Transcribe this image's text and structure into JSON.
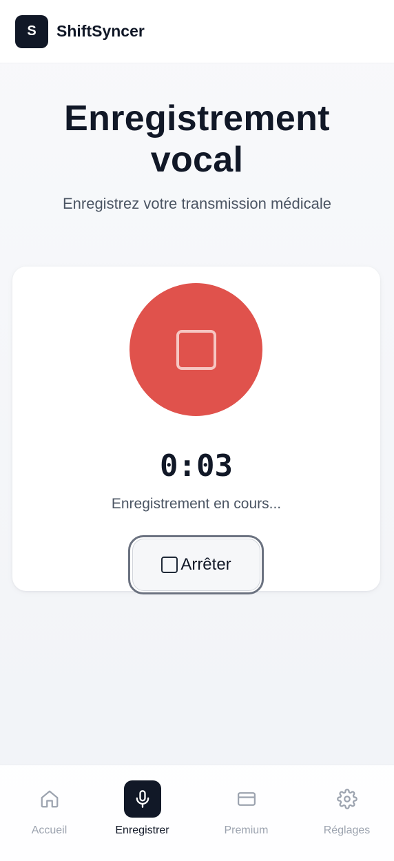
{
  "app": {
    "logo_letter": "S",
    "name": "ShiftSyncer"
  },
  "page": {
    "title_line1": "Enregistrement",
    "title_line2": "vocal",
    "subtitle": "Enregistrez votre transmission médicale"
  },
  "recorder": {
    "timer": "0:03",
    "status": "Enregistrement en cours...",
    "stop_label": "Arrêter",
    "accent_color": "#e0524c"
  },
  "nav": {
    "items": [
      {
        "label": "Accueil",
        "icon": "home-icon"
      },
      {
        "label": "Enregistrer",
        "icon": "microphone-icon",
        "active": true
      },
      {
        "label": "Premium",
        "icon": "credit-card-icon"
      },
      {
        "label": "Réglages",
        "icon": "gear-icon"
      }
    ]
  }
}
